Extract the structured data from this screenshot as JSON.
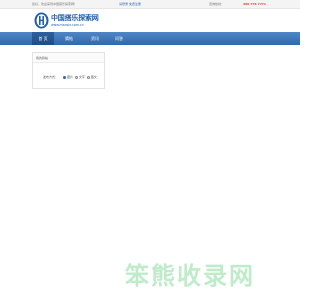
{
  "topbar": {
    "greeting": "您好，欢迎来到中国搭乐探索网！",
    "login": "请登录",
    "register": "免费注册",
    "hotline_label": "咨询热线：",
    "hotline": "400 778 7771"
  },
  "logo": {
    "title": "中国搭乐探索网",
    "url": "www.mansix.com.cn"
  },
  "nav": {
    "items": [
      {
        "label": "首 页"
      },
      {
        "label": "猜帖"
      },
      {
        "label": "资讯"
      },
      {
        "label": "问答"
      }
    ]
  },
  "panel": {
    "title": "我的猜帖",
    "row_label": "发布方式：",
    "options": [
      "图片",
      "文字",
      "图文"
    ],
    "selected_index": 0
  },
  "watermark": "笨熊收录网",
  "colors": {
    "brand_blue": "#2f68ac",
    "hotline_red": "#e8382f",
    "watermark_green": "#b5e8c3"
  }
}
